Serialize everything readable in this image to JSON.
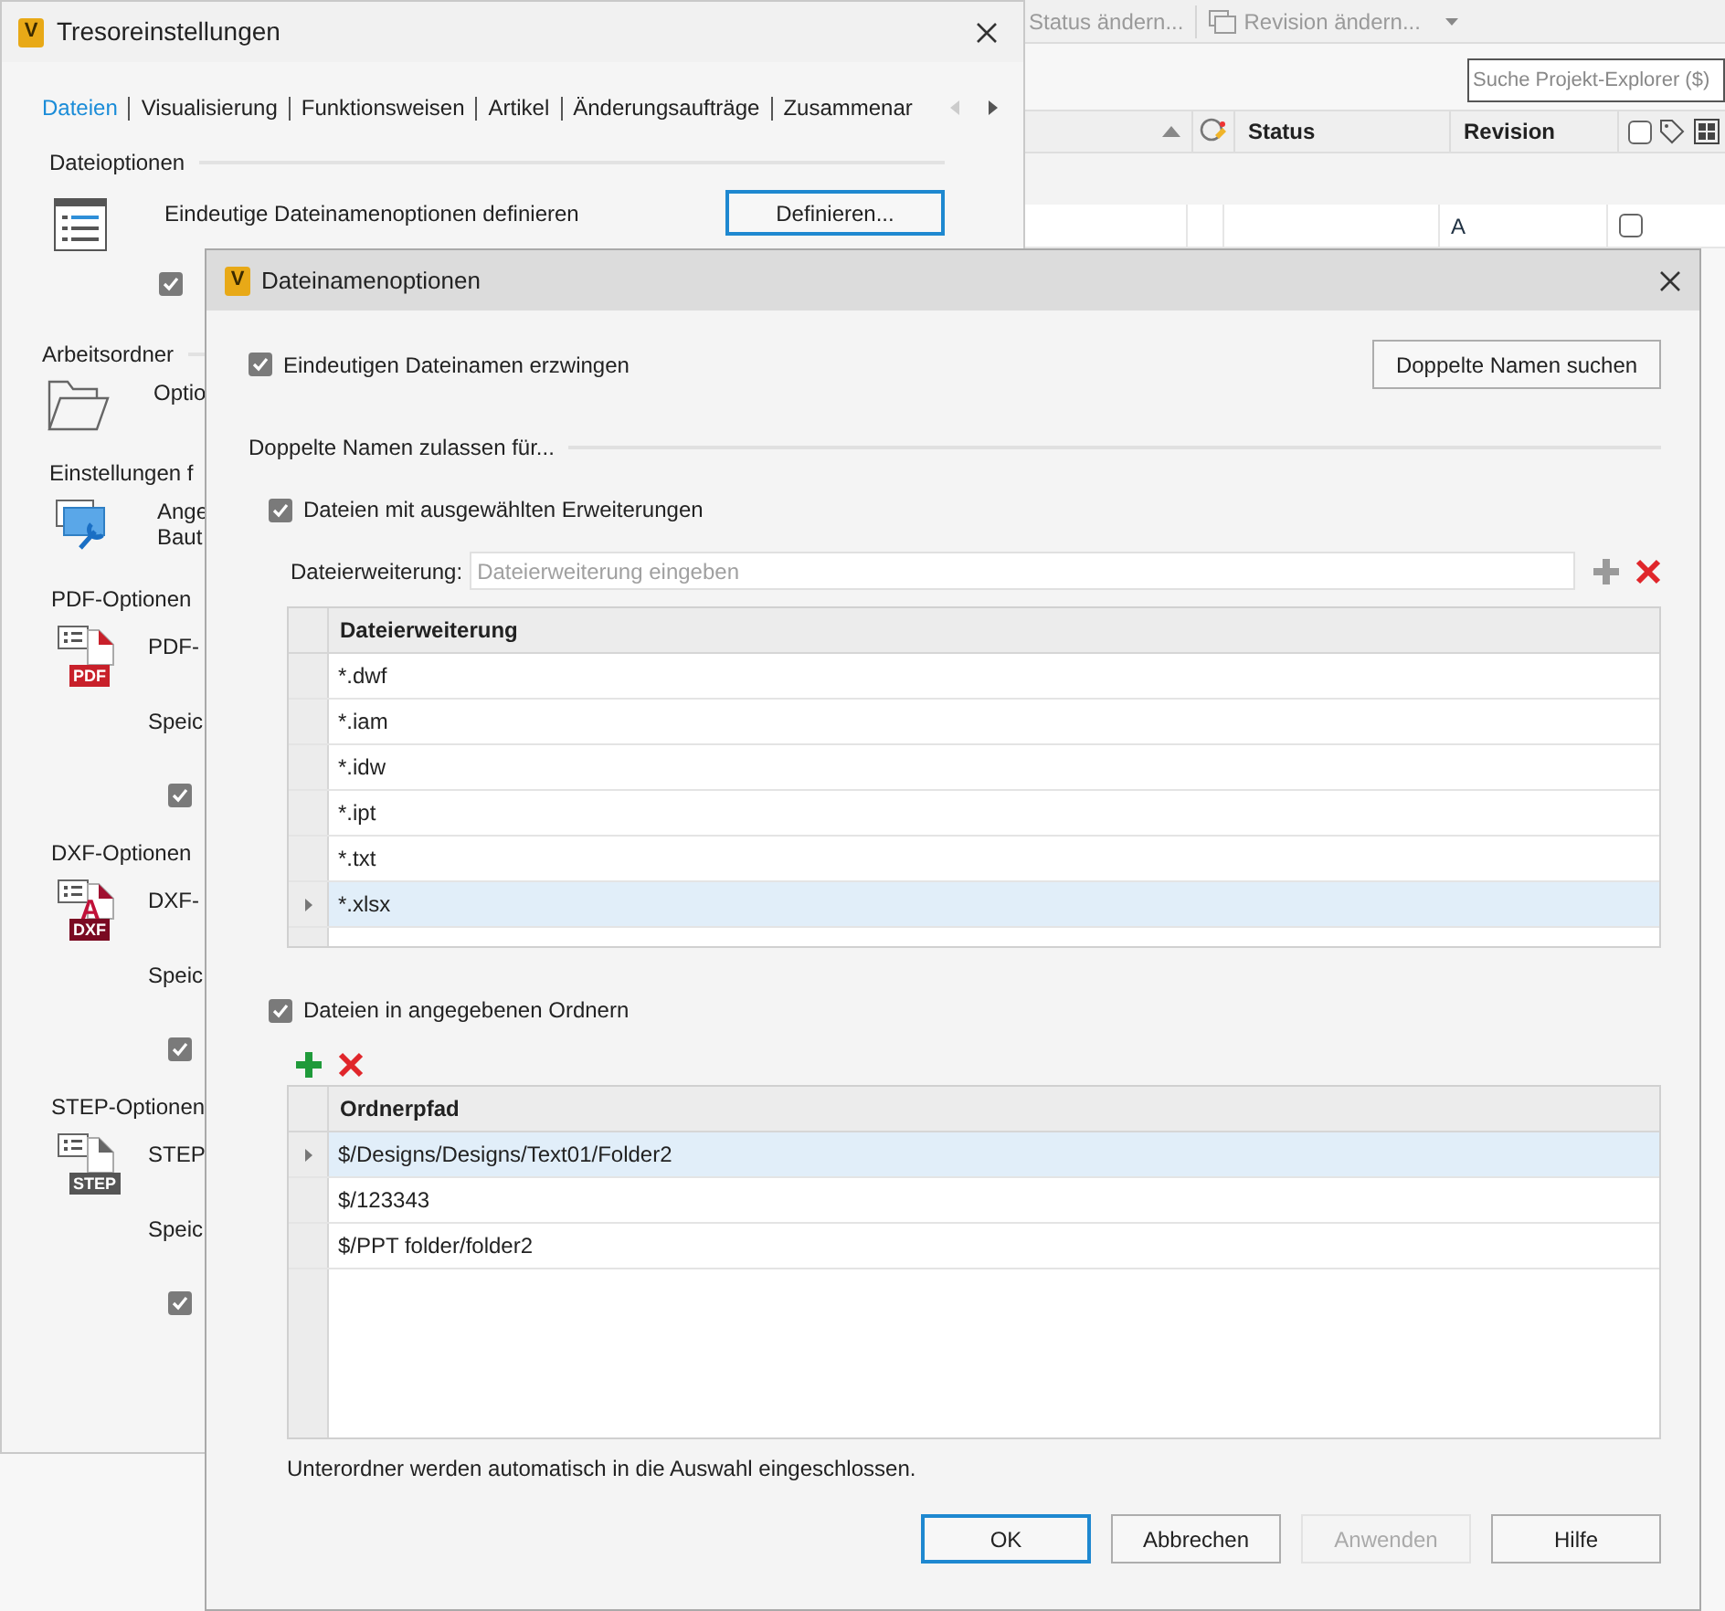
{
  "background_app": {
    "toolbar": [
      {
        "label": "Status ändern...",
        "disabled": true,
        "kind": "plain"
      },
      {
        "label": "Revision ändern...",
        "disabled": true,
        "kind": "dropdown"
      }
    ],
    "search": {
      "placeholder": "Suche Projekt-Explorer ($)"
    },
    "columns": [
      {
        "label": "Status"
      },
      {
        "label": "Revision"
      }
    ],
    "header_checked": false,
    "rows": [
      {
        "revision": "A",
        "checked": false
      }
    ]
  },
  "settings_window": {
    "logo": "V",
    "title": "Tresoreinstellungen",
    "tabs": [
      {
        "label": "Dateien",
        "selected": true
      },
      {
        "label": "Visualisierung",
        "selected": false
      },
      {
        "label": "Funktionsweisen",
        "selected": false
      },
      {
        "label": "Artikel",
        "selected": false
      },
      {
        "label": "Änderungsaufträge",
        "selected": false
      },
      {
        "label": "Zusammenar",
        "selected": false
      }
    ],
    "sections": [
      {
        "kind": "file",
        "heading": "Dateioptionen",
        "text": "Eindeutige Dateinamenoptionen definieren",
        "button": "Definieren...",
        "option": {
          "checked": true
        }
      },
      {
        "kind": "folder",
        "heading": "Arbeitsordner",
        "lines": [
          "Optio"
        ]
      },
      {
        "kind": "tools",
        "heading": "Einstellungen f",
        "lines": [
          "Ange",
          "Baut"
        ]
      },
      {
        "kind": "export",
        "heading": "PDF-Optionen",
        "icon_label": "PDF",
        "lines": [
          "PDF-"
        ],
        "setting": "Speic",
        "checked": true
      },
      {
        "kind": "export",
        "heading": "DXF-Optionen",
        "icon_label": "DXF",
        "icon_mark": "A",
        "lines": [
          "DXF-"
        ],
        "setting": "Speic",
        "checked": true
      },
      {
        "kind": "export",
        "heading": "STEP-Optionen",
        "icon_label": "STEP",
        "lines": [
          "STEP"
        ],
        "setting": "Speic",
        "checked": true
      }
    ]
  },
  "dialog": {
    "logo": "V",
    "title": "Dateinamenoptionen",
    "enforce": {
      "label": "Eindeutigen Dateinamen erzwingen",
      "checked": true
    },
    "find_button": "Doppelte Namen suchen",
    "group_heading": "Doppelte Namen zulassen für...",
    "extensions": {
      "label": "Dateien mit ausgewählten Erweiterungen",
      "checked": true,
      "field_label": "Dateierweiterung:",
      "placeholder": "Dateierweiterung eingeben",
      "column": "Dateierweiterung",
      "rows": [
        {
          "value": "*.dwf",
          "selected": false
        },
        {
          "value": "*.iam",
          "selected": false
        },
        {
          "value": "*.idw",
          "selected": false
        },
        {
          "value": "*.ipt",
          "selected": false
        },
        {
          "value": "*.txt",
          "selected": false
        },
        {
          "value": "*.xlsx",
          "selected": true
        }
      ]
    },
    "folders": {
      "label": "Dateien in angegebenen Ordnern",
      "checked": true,
      "column": "Ordnerpfad",
      "rows": [
        {
          "value": "$/Designs/Designs/Text01/Folder2",
          "selected": true
        },
        {
          "value": "$/123343",
          "selected": false
        },
        {
          "value": "$/PPT folder/folder2",
          "selected": false
        }
      ]
    },
    "note": "Unterordner werden automatisch in die Auswahl eingeschlossen.",
    "buttons": [
      {
        "label": "OK",
        "kind": "default",
        "disabled": false
      },
      {
        "label": "Abbrechen",
        "kind": "normal",
        "disabled": false
      },
      {
        "label": "Anwenden",
        "kind": "normal",
        "disabled": true
      },
      {
        "label": "Hilfe",
        "kind": "normal",
        "disabled": false
      }
    ]
  }
}
